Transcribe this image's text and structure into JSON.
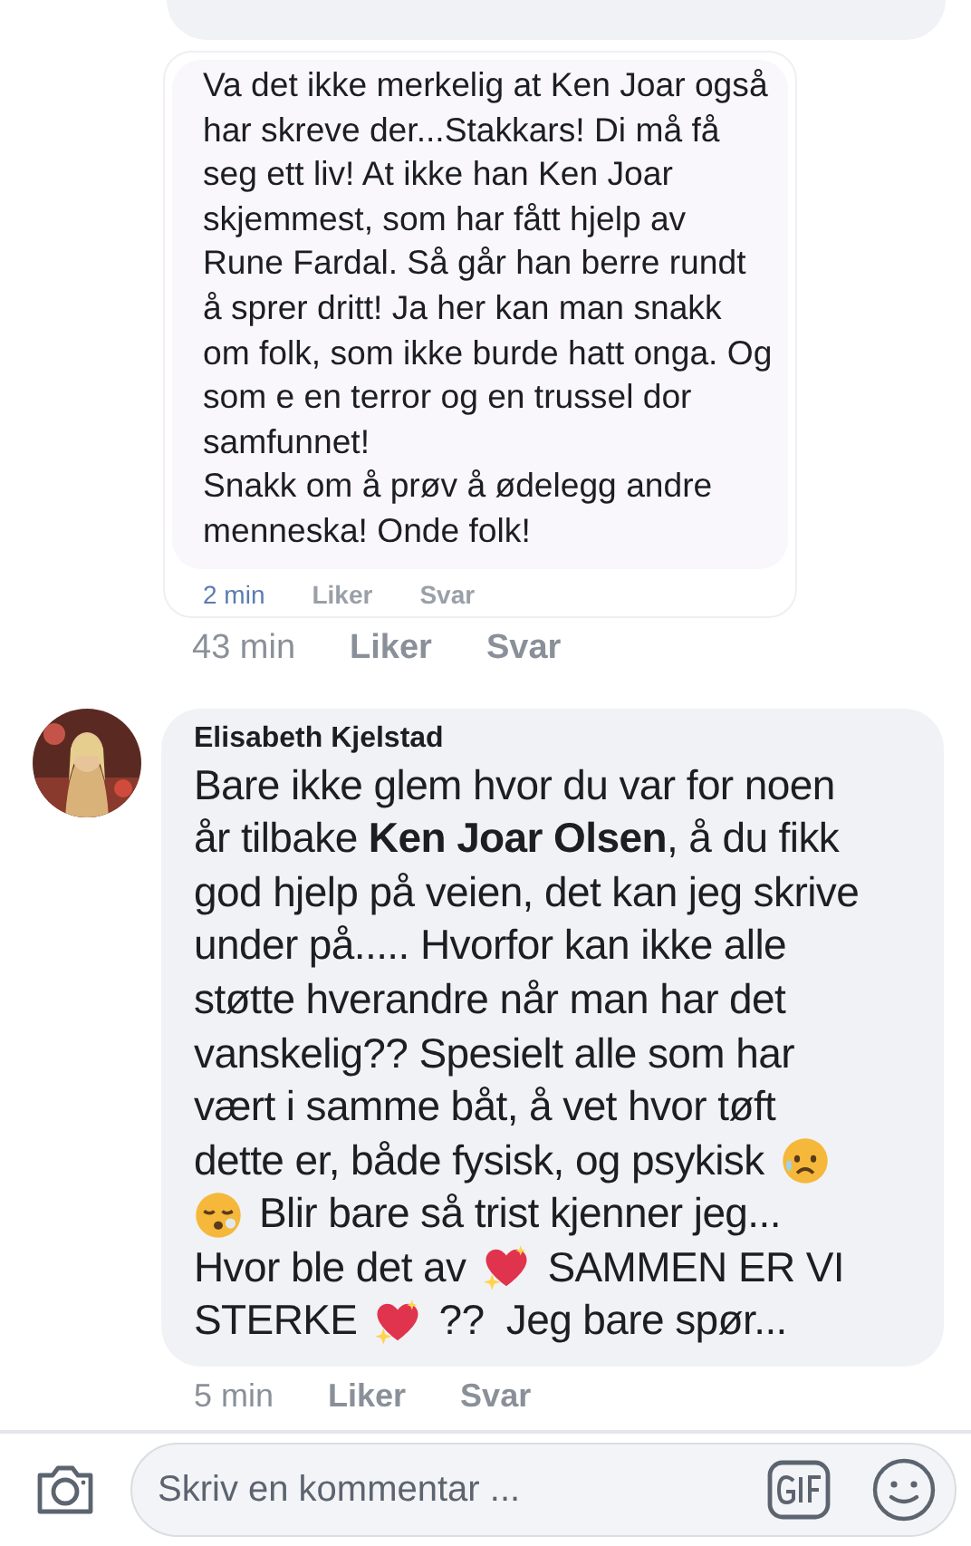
{
  "thread": [
    {
      "kind": "quoted",
      "quote": {
        "text": "Va det ikke merkelig at Ken Joar også har skreve der...Stakkars! Di må få seg ett liv! At ikke han Ken Joar skjemmest, som har fått hjelp av Rune Fardal. Så går han berre rundt å sprer dritt! Ja her kan man snakk om folk, som ikke burde hatt onga. Og som e en terror og en trussel dor samfunnet!\nSnakk om å prøv å ødelegg andre menneska! Onde folk!",
        "time": "2 min",
        "like": "Liker",
        "reply": "Svar"
      },
      "time": "43 min",
      "like": "Liker",
      "reply": "Svar"
    },
    {
      "kind": "comment",
      "author": "Elisabeth Kjelstad",
      "lines": [
        [
          {
            "kind": "text",
            "text": "Bare ikke glem hvor du var for noen"
          }
        ],
        [
          {
            "kind": "text",
            "text": "år tilbake **Ken Joar Olsen**, å du fikk"
          }
        ],
        [
          {
            "kind": "text",
            "text": "god hjelp på veien, det kan jeg skrive"
          }
        ],
        [
          {
            "kind": "text",
            "text": "under på..... Hvorfor kan ikke alle"
          }
        ],
        [
          {
            "kind": "text",
            "text": "støtte hverandre når man har det"
          }
        ],
        [
          {
            "kind": "text",
            "text": "vanskelig?? Spesielt alle som har"
          }
        ],
        [
          {
            "kind": "text",
            "text": "vært i samme båt, å vet hvor tøft"
          }
        ],
        [
          {
            "kind": "text",
            "text": "dette er, både fysisk, og psykisk"
          },
          {
            "kind": "sad-emoji"
          }
        ],
        [
          {
            "kind": "sleepy-emoji"
          },
          {
            "kind": "text",
            "text": "Blir bare så trist kjenner jeg..."
          }
        ],
        [
          {
            "kind": "text",
            "text": "Hvor ble det av"
          },
          {
            "kind": "heart-emoji"
          },
          {
            "kind": "text",
            "text": "SAMMEN ER VI"
          }
        ],
        [
          {
            "kind": "text",
            "text": "STERKE"
          },
          {
            "kind": "heart-emoji"
          },
          {
            "kind": "text",
            "text": "??  Jeg bare spør..."
          }
        ]
      ],
      "time": "5 min",
      "like": "Liker",
      "reply": "Svar"
    }
  ],
  "composer": {
    "placeholder": "Skriv en kommentar ..."
  }
}
